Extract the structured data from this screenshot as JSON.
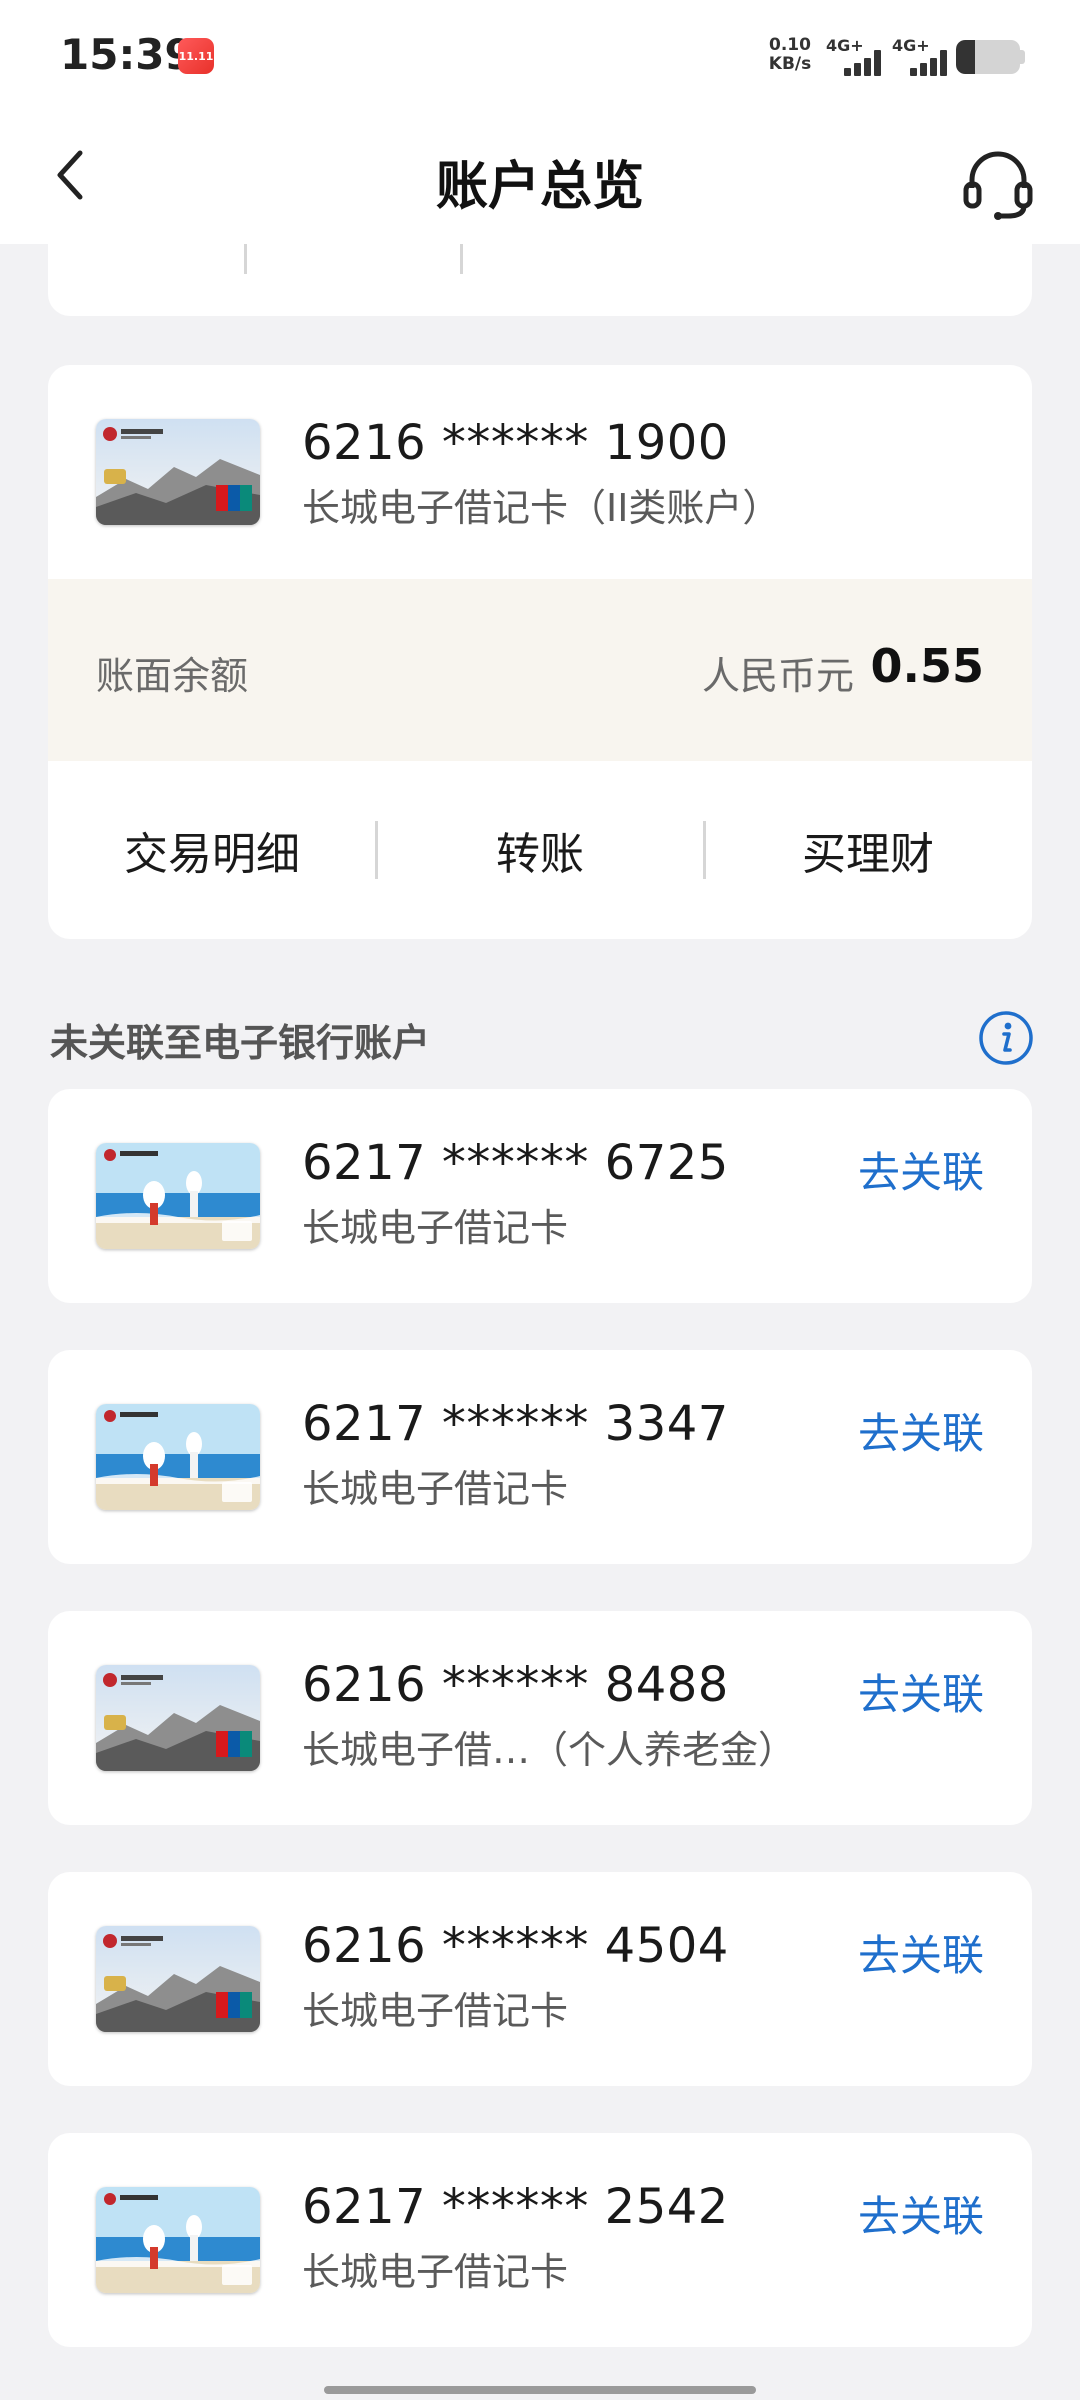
{
  "status_bar": {
    "time": "15:39",
    "app_badge": "11.11",
    "net_speed_value": "0.10",
    "net_speed_unit": "KB/s",
    "signal_1": "4G+",
    "signal_2": "4G+",
    "battery_level": 0.3
  },
  "header": {
    "title": "账户总览",
    "back_icon": "chevron-left-icon",
    "service_icon": "headset-icon"
  },
  "linked_card": {
    "number": "6216 ****** 1900",
    "name": "长城电子借记卡（II类账户）",
    "card_art": "great-wall",
    "balance_label": "账面余额",
    "currency": "人民币元",
    "balance": "0.55",
    "actions": [
      "交易明细",
      "转账",
      "买理财"
    ]
  },
  "unlinked_section": {
    "title": "未关联至电子银行账户",
    "info_icon": "info-icon",
    "accounts": [
      {
        "number": "6217 ****** 6725",
        "name": "长城电子借记卡",
        "action": "去关联",
        "card_art": "beach"
      },
      {
        "number": "6217 ****** 3347",
        "name": "长城电子借记卡",
        "action": "去关联",
        "card_art": "beach"
      },
      {
        "number": "6216 ****** 8488",
        "name": "长城电子借…（个人养老金）",
        "action": "去关联",
        "card_art": "great-wall"
      },
      {
        "number": "6216 ****** 4504",
        "name": "长城电子借记卡",
        "action": "去关联",
        "card_art": "great-wall"
      },
      {
        "number": "6217 ****** 2542",
        "name": "长城电子借记卡",
        "action": "去关联",
        "card_art": "beach"
      }
    ]
  },
  "colors": {
    "accent": "#1f6fcc",
    "background": "#f2f2f4",
    "balance_band": "#f8f5ef"
  }
}
